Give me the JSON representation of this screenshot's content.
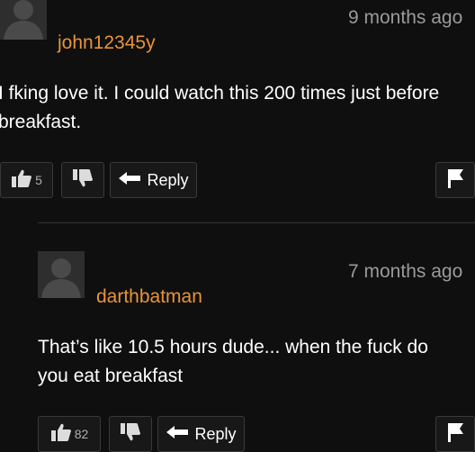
{
  "comments": [
    {
      "username": "john12345y",
      "timestamp": "9 months ago",
      "text": "I fking love it. I could watch this 200 times just before breakfast.",
      "likes": "5",
      "reply_label": "Reply",
      "icons": [
        "avatar-icon",
        "thumbs-up-icon",
        "thumbs-down-icon",
        "reply-arrow-icon",
        "flag-icon"
      ]
    },
    {
      "username": "darthbatman",
      "timestamp": "7 months ago",
      "text": "That’s like 10.5 hours dude... when the fuck do you eat breakfast",
      "likes": "82",
      "reply_label": "Reply",
      "icons": [
        "avatar-icon",
        "thumbs-up-icon",
        "thumbs-down-icon",
        "reply-arrow-icon",
        "flag-icon"
      ]
    }
  ],
  "colors": {
    "background": "#0f0f0f",
    "username": "#e8943a",
    "timestamp": "#9a9a9a",
    "text": "#ffffff",
    "button_border": "#3a3a3a"
  }
}
